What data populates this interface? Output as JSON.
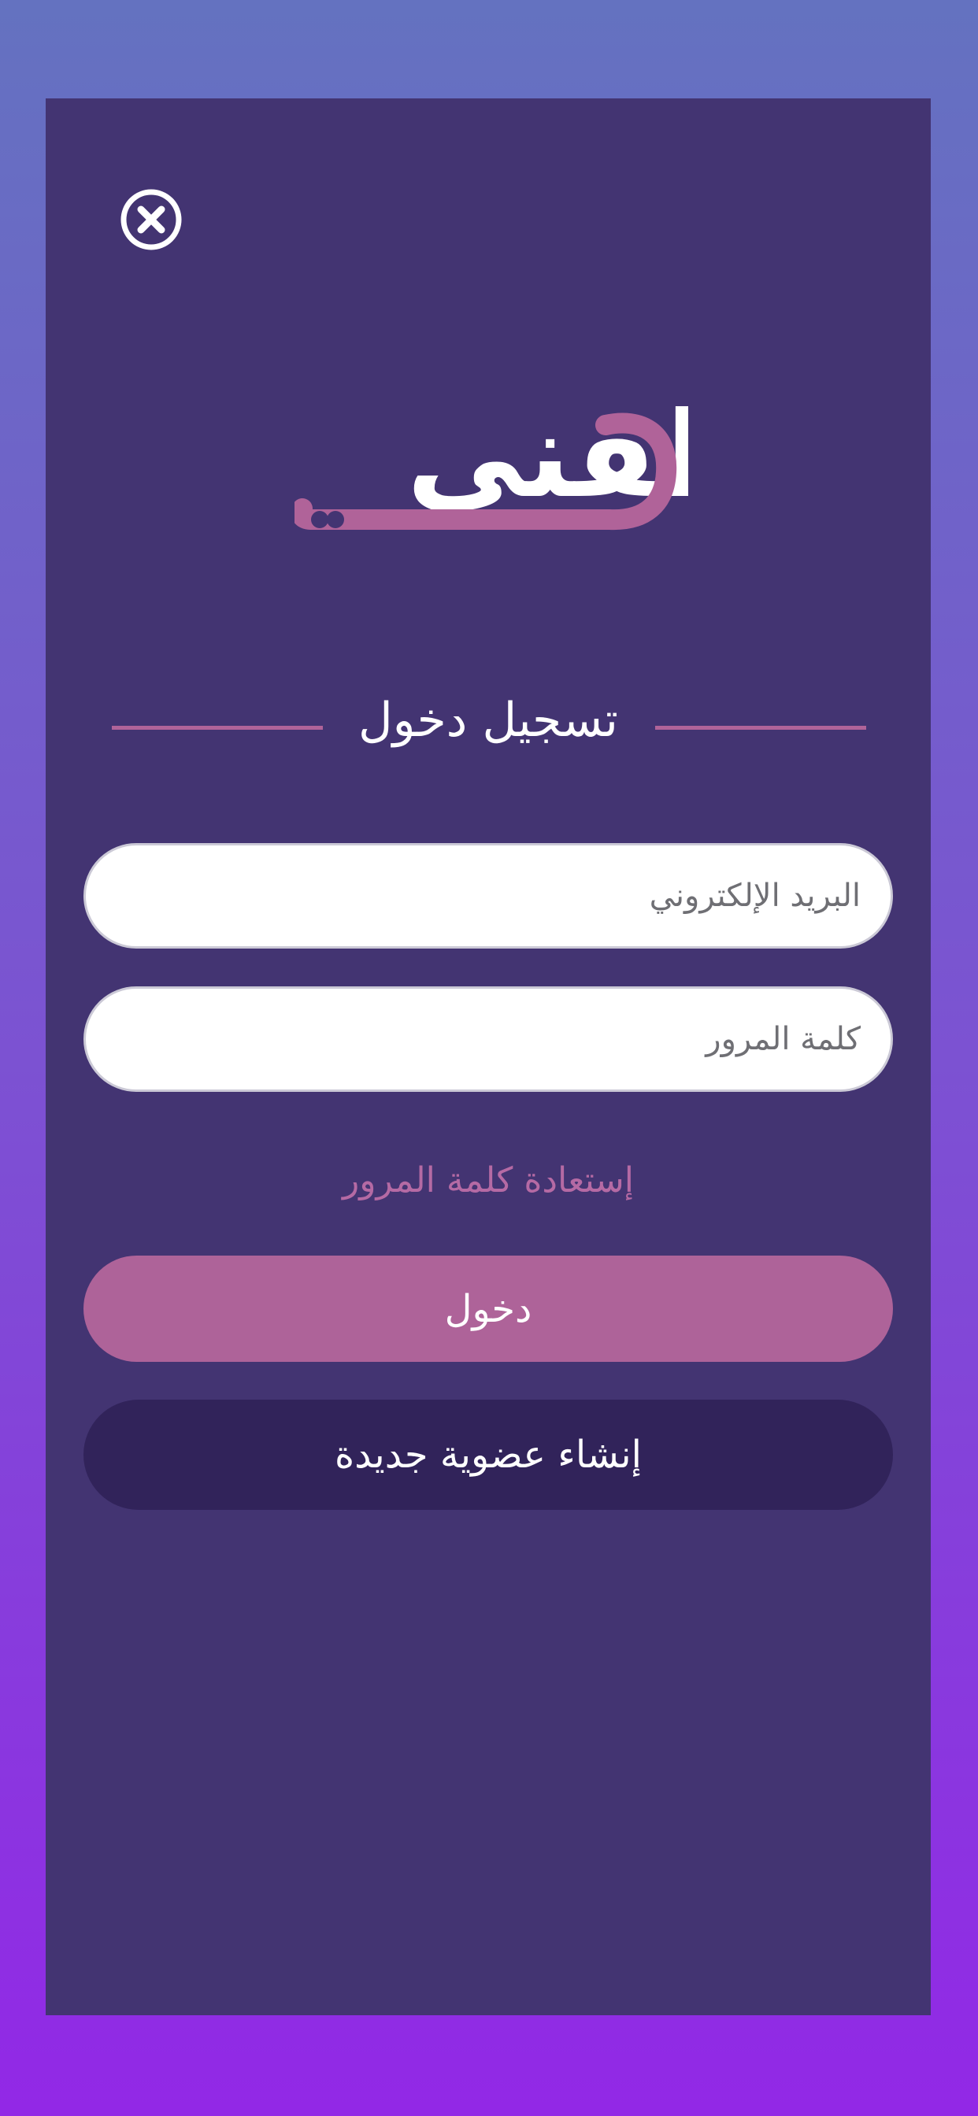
{
  "header": {
    "close_icon": "close-circle-icon"
  },
  "brand": {
    "logo_text": "وظفني",
    "logo_primary_color": "#ffffff",
    "logo_accent_color": "#b06399"
  },
  "login": {
    "title": "تسجيل دخول",
    "email_placeholder": "البريد الإلكتروني",
    "password_placeholder": "كلمة المرور",
    "forgot_password_label": "إستعادة كلمة المرور",
    "login_button_label": "دخول",
    "register_button_label": "إنشاء عضوية جديدة"
  },
  "colors": {
    "panel_bg": "#433472",
    "accent": "#ae6399",
    "secondary_button": "#31235a"
  }
}
